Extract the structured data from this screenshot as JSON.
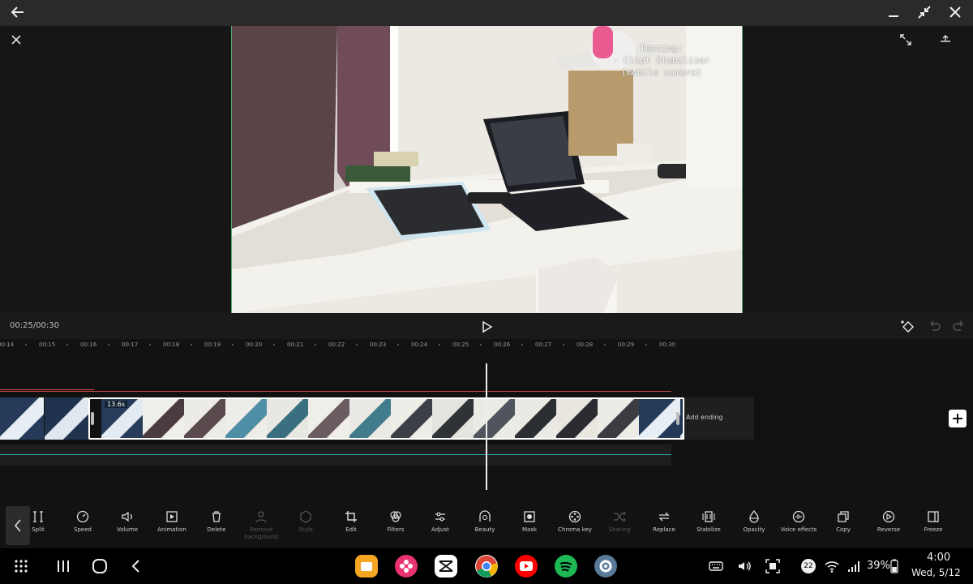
{
  "window": {
    "back_icon": "arrow-left-icon"
  },
  "preview": {
    "overlay_text_lines": [
      "Testing:",
      "- Clipt Stabilizer",
      "(mobile camera)"
    ]
  },
  "playback": {
    "timecode": "00:25/00:30"
  },
  "ruler": {
    "ticks": [
      "00:14",
      "00:15",
      "00:16",
      "00:17",
      "00:18",
      "00:19",
      "00:20",
      "00:21",
      "00:22",
      "00:23",
      "00:24",
      "00:25",
      "00:26",
      "00:27",
      "00:28",
      "00:29",
      "00:30"
    ]
  },
  "timeline": {
    "clip_duration": "13.6s",
    "add_ending": "Add ending"
  },
  "toolbar": {
    "tools": [
      {
        "label": "Split",
        "icon": "split-icon",
        "disabled": false
      },
      {
        "label": "Speed",
        "icon": "speed-icon",
        "disabled": false
      },
      {
        "label": "Volume",
        "icon": "volume-icon",
        "disabled": false
      },
      {
        "label": "Animation",
        "icon": "animation-icon",
        "disabled": false
      },
      {
        "label": "Delete",
        "icon": "trash-icon",
        "disabled": false
      },
      {
        "label": "Remove background",
        "icon": "person-icon",
        "disabled": true
      },
      {
        "label": "Style",
        "icon": "cube-icon",
        "disabled": true
      },
      {
        "label": "Edit",
        "icon": "crop-icon",
        "disabled": false
      },
      {
        "label": "Filters",
        "icon": "filters-icon",
        "disabled": false
      },
      {
        "label": "Adjust",
        "icon": "sliders-icon",
        "disabled": false
      },
      {
        "label": "Beauty",
        "icon": "face-icon",
        "disabled": false
      },
      {
        "label": "Mask",
        "icon": "mask-icon",
        "disabled": false
      },
      {
        "label": "Chroma key",
        "icon": "chroma-icon",
        "disabled": false
      },
      {
        "label": "Sharing",
        "icon": "shuffle-icon",
        "disabled": true
      },
      {
        "label": "Replace",
        "icon": "replace-icon",
        "disabled": false
      },
      {
        "label": "Stabilize",
        "icon": "stabilize-icon",
        "disabled": false
      },
      {
        "label": "Opacity",
        "icon": "drop-icon",
        "disabled": false
      },
      {
        "label": "Voice effects",
        "icon": "voice-icon",
        "disabled": false
      },
      {
        "label": "Copy",
        "icon": "copy-icon",
        "disabled": false
      },
      {
        "label": "Reverse",
        "icon": "reverse-icon",
        "disabled": false
      },
      {
        "label": "Freeze",
        "icon": "freeze-icon",
        "disabled": false
      }
    ]
  },
  "statusbar": {
    "notification_count": "22",
    "battery": "39%",
    "time": "4:00",
    "date": "Wed, 5/12"
  },
  "colors": {
    "accent": "#e04848",
    "track": "#2aa9a9"
  }
}
